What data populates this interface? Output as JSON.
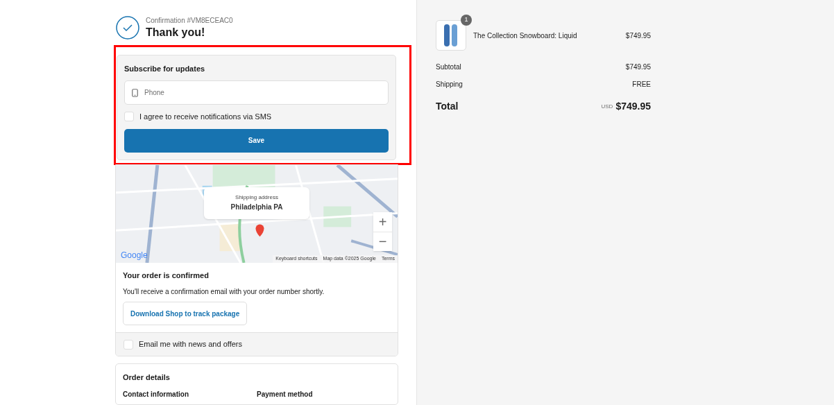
{
  "header": {
    "confirmation": "Confirmation #VM8ECEAC0",
    "title": "Thank you!"
  },
  "subscribe": {
    "highlighted": true,
    "title": "Subscribe for updates",
    "phone": {
      "placeholder": "Phone"
    },
    "sms_consent": {
      "label": "I agree to receive notifications via SMS",
      "checked": false
    },
    "button": "Save"
  },
  "map": {
    "kind": "picture",
    "popup": {
      "label": "Shipping address",
      "value": "Philadelphia PA"
    },
    "zoom_in": "+",
    "zoom_out": "−",
    "logo": "Google",
    "footer": [
      "Keyboard shortcuts",
      "Map data ©2025 Google",
      "Terms"
    ]
  },
  "order_confirmed": {
    "title": "Your order is confirmed",
    "text": "You'll receive a confirmation email with your order number shortly.",
    "button": "Download Shop to track package",
    "email_consent": {
      "label": "Email me with news and offers",
      "checked": false
    }
  },
  "order_details": {
    "title": "Order details",
    "columns": [
      "Contact information",
      "Payment method"
    ]
  },
  "summary": {
    "item": {
      "quantity": "1",
      "name": "The Collection Snowboard: Liquid",
      "price": "$749.95"
    },
    "lines": [
      {
        "label": "Subtotal",
        "value": "$749.95"
      },
      {
        "label": "Shipping",
        "value": "FREE"
      }
    ],
    "total": {
      "label": "Total",
      "currency": "USD",
      "value": "$749.95"
    }
  }
}
